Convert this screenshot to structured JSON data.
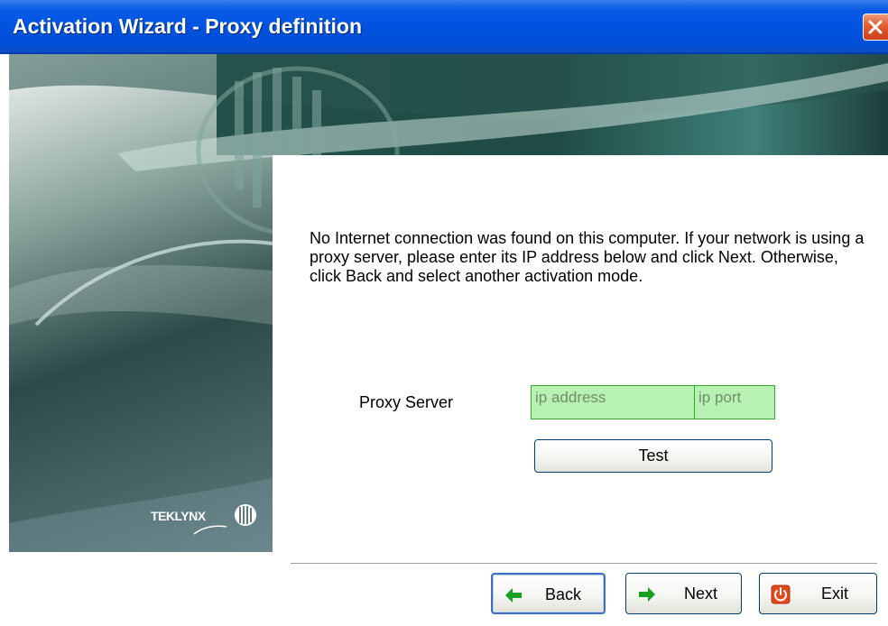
{
  "window": {
    "title": "Activation Wizard - Proxy definition"
  },
  "banner": {
    "logo_text": "TEKLYNX"
  },
  "content": {
    "message": "No Internet connection was found on this computer. If your network is using a proxy server, please enter its IP address below and click Next. Otherwise, click Back and select another activation mode.",
    "proxy_label": "Proxy Server",
    "ip_address": {
      "placeholder": "ip address",
      "value": ""
    },
    "ip_port": {
      "placeholder": "ip port",
      "value": ""
    },
    "test_label": "Test"
  },
  "buttons": {
    "back_label": "Back",
    "next_label": "Next",
    "exit_label": "Exit"
  },
  "colors": {
    "titlebar": "#0053e0",
    "input_background": "#b8f2b3",
    "input_border": "#2faa2a",
    "arrow_green": "#16a020",
    "exit_red": "#e04a1a"
  },
  "icons": {
    "close": "close-icon",
    "back": "arrow-left-icon",
    "next": "arrow-right-icon",
    "exit": "power-icon"
  }
}
